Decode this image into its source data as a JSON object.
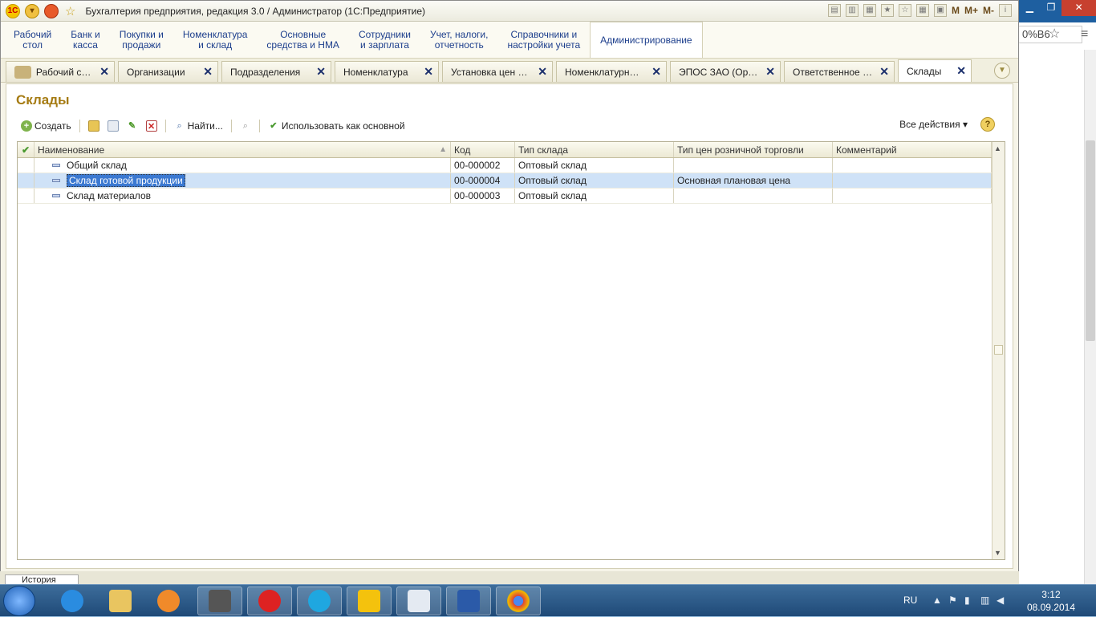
{
  "window": {
    "title": "Бухгалтерия предприятия, редакция 3.0 / Администратор  (1С:Предприятие)",
    "right_buttons": [
      "M",
      "M+",
      "M-"
    ],
    "logo": "1С"
  },
  "browser": {
    "zoom_text": "0%В6"
  },
  "sections": [
    {
      "label": "Рабочий\nстол"
    },
    {
      "label": "Банк и\nкасса"
    },
    {
      "label": "Покупки и\nпродажи"
    },
    {
      "label": "Номенклатура\nи склад"
    },
    {
      "label": "Основные\nсредства и НМА"
    },
    {
      "label": "Сотрудники\nи зарплата"
    },
    {
      "label": "Учет, налоги,\nотчетность"
    },
    {
      "label": "Справочники и\nнастройки учета"
    },
    {
      "label": "Администрирование"
    }
  ],
  "tabs": [
    {
      "label": "Рабочий стол"
    },
    {
      "label": "Организации"
    },
    {
      "label": "Подразделения"
    },
    {
      "label": "Номенклатура"
    },
    {
      "label": "Установка цен но..."
    },
    {
      "label": "Номенклатурные ..."
    },
    {
      "label": "ЭПОС ЗАО (Орган..."
    },
    {
      "label": "Ответственное ли..."
    },
    {
      "label": "Склады"
    }
  ],
  "form": {
    "title": "Склады",
    "toolbar": {
      "create": "Создать",
      "find": "Найти...",
      "use_main": "Использовать как основной",
      "all_actions": "Все действия",
      "help": "?"
    },
    "columns": [
      "Наименование",
      "Код",
      "Тип склада",
      "Тип цен розничной торговли",
      "Комментарий"
    ],
    "rows": [
      {
        "name": "Общий склад",
        "code": "00-000002",
        "type": "Оптовый склад",
        "price_type": "",
        "comment": ""
      },
      {
        "name": "Склад готовой продукции",
        "code": "00-000004",
        "type": "Оптовый склад",
        "price_type": "Основная плановая цена",
        "comment": ""
      },
      {
        "name": "Склад материалов",
        "code": "00-000003",
        "type": "Оптовый склад",
        "price_type": "",
        "comment": ""
      }
    ]
  },
  "history": {
    "label": "История"
  },
  "tray": {
    "lang": "RU",
    "time": "3:12",
    "date": "08.09.2014"
  }
}
